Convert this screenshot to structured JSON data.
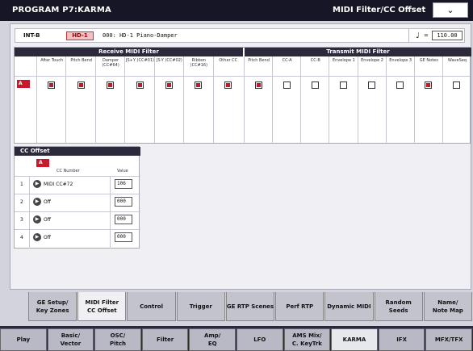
{
  "header": {
    "title": "PROGRAM P7:KARMA",
    "page": "MIDI Filter/CC Offset",
    "menu_icon": "chevron-down-icon",
    "menu_symbol": "⌄"
  },
  "program": {
    "bank": "INT-B",
    "badge": "HD-1",
    "name": "000: HD-1 Piano-Damper"
  },
  "tempo": {
    "symbol": "♩",
    "eq": "=",
    "value": "110.00"
  },
  "receive": {
    "title": "Receive MIDI Filter",
    "columns": [
      "After Touch",
      "Pitch Bend",
      "Damper (CC#64)",
      "JS+Y (CC#01)",
      "JS-Y (CC#02)",
      "Ribbon (CC#16)",
      "Other CC"
    ],
    "checked": [
      true,
      true,
      true,
      true,
      true,
      true,
      true
    ]
  },
  "transmit": {
    "title": "Transmit MIDI Filter",
    "columns": [
      "Pitch Bend",
      "CC-A",
      "CC-B",
      "Envelope 1",
      "Envelope 2",
      "Envelope 3",
      "GE Notes",
      "WaveSeq"
    ],
    "checked": [
      true,
      false,
      false,
      false,
      false,
      false,
      true,
      false
    ]
  },
  "row_label": "A",
  "cc_offset": {
    "title": "CC Offset",
    "module": "A",
    "col_number": "CC Number",
    "col_value": "Value",
    "rows": [
      {
        "index": "1",
        "cc": "MIDI CC#72",
        "value": "106"
      },
      {
        "index": "2",
        "cc": "Off",
        "value": "000"
      },
      {
        "index": "3",
        "cc": "Off",
        "value": "000"
      },
      {
        "index": "4",
        "cc": "Off",
        "value": "000"
      }
    ]
  },
  "tabs": [
    "GE Setup/ Key Zones",
    "MIDI Filter CC Offset",
    "Control",
    "Trigger",
    "GE RTP Scenes",
    "Perf RTP",
    "Dynamic MIDI",
    "Random Seeds",
    "Name/ Note Map"
  ],
  "bottom_tabs": [
    "Play",
    "Basic/ Vector",
    "OSC/ Pitch",
    "Filter",
    "Amp/ EQ",
    "LFO",
    "AMS Mix/ C. KeyTrk",
    "KARMA",
    "IFX",
    "MFX/TFX"
  ]
}
